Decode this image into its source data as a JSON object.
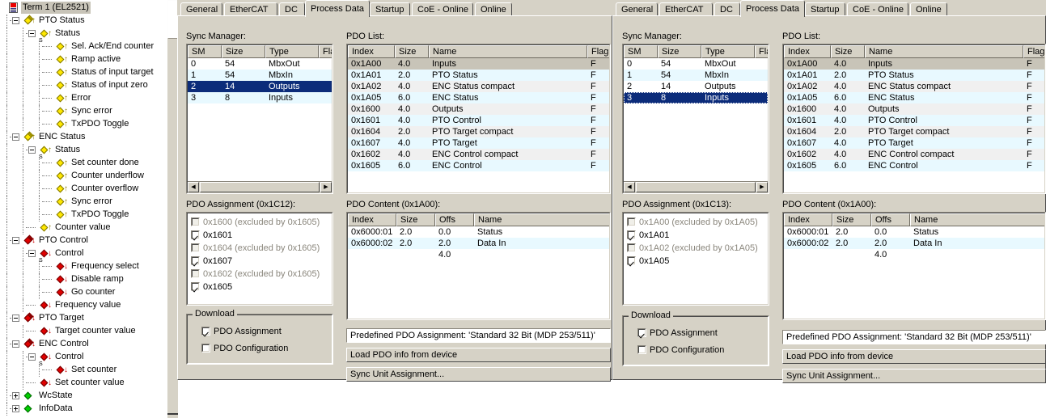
{
  "tree": {
    "root": {
      "label": "Term 1 (EL2521)",
      "icon": "terminal-icon",
      "selected": true
    },
    "nodes": [
      {
        "label": "PTO Status",
        "depth": 1,
        "icon": "pdo-group-input-icon",
        "expander": "minus"
      },
      {
        "label": "Status",
        "depth": 2,
        "icon": "pdo-entry-input-icon",
        "expander": "minus",
        "sub": "S"
      },
      {
        "label": "Sel. Ack/End counter",
        "depth": 3,
        "icon": "variable-input-icon"
      },
      {
        "label": "Ramp active",
        "depth": 3,
        "icon": "variable-input-icon"
      },
      {
        "label": "Status of input target",
        "depth": 3,
        "icon": "variable-input-icon"
      },
      {
        "label": "Status of input zero",
        "depth": 3,
        "icon": "variable-input-icon"
      },
      {
        "label": "Error",
        "depth": 3,
        "icon": "variable-input-icon"
      },
      {
        "label": "Sync error",
        "depth": 3,
        "icon": "variable-input-icon"
      },
      {
        "label": "TxPDO Toggle",
        "depth": 3,
        "icon": "variable-input-icon"
      },
      {
        "label": "ENC Status",
        "depth": 1,
        "icon": "pdo-group-input-icon",
        "expander": "minus"
      },
      {
        "label": "Status",
        "depth": 2,
        "icon": "pdo-entry-input-icon",
        "expander": "minus",
        "sub": "S"
      },
      {
        "label": "Set counter done",
        "depth": 3,
        "icon": "variable-input-icon"
      },
      {
        "label": "Counter underflow",
        "depth": 3,
        "icon": "variable-input-icon"
      },
      {
        "label": "Counter overflow",
        "depth": 3,
        "icon": "variable-input-icon"
      },
      {
        "label": "Sync error",
        "depth": 3,
        "icon": "variable-input-icon"
      },
      {
        "label": "TxPDO Toggle",
        "depth": 3,
        "icon": "variable-input-icon"
      },
      {
        "label": "Counter value",
        "depth": 2,
        "icon": "variable-input-icon"
      },
      {
        "label": "PTO Control",
        "depth": 1,
        "icon": "pdo-group-output-icon",
        "expander": "minus"
      },
      {
        "label": "Control",
        "depth": 2,
        "icon": "pdo-entry-output-icon",
        "expander": "minus",
        "sub": "S"
      },
      {
        "label": "Frequency select",
        "depth": 3,
        "icon": "variable-output-icon"
      },
      {
        "label": "Disable ramp",
        "depth": 3,
        "icon": "variable-output-icon"
      },
      {
        "label": "Go counter",
        "depth": 3,
        "icon": "variable-output-icon"
      },
      {
        "label": "Frequency value",
        "depth": 2,
        "icon": "variable-output-icon"
      },
      {
        "label": "PTO Target",
        "depth": 1,
        "icon": "pdo-group-output-icon",
        "expander": "minus"
      },
      {
        "label": "Target counter value",
        "depth": 2,
        "icon": "variable-output-icon"
      },
      {
        "label": "ENC Control",
        "depth": 1,
        "icon": "pdo-group-output-icon",
        "expander": "minus"
      },
      {
        "label": "Control",
        "depth": 2,
        "icon": "pdo-entry-output-icon",
        "expander": "minus",
        "sub": "S"
      },
      {
        "label": "Set counter",
        "depth": 3,
        "icon": "variable-output-icon"
      },
      {
        "label": "Set counter value",
        "depth": 2,
        "icon": "variable-output-icon"
      },
      {
        "label": "WcState",
        "depth": 1,
        "icon": "wcstate-icon",
        "expander": "plus"
      },
      {
        "label": "InfoData",
        "depth": 1,
        "icon": "infodata-icon",
        "expander": "plus"
      }
    ]
  },
  "tabs": [
    "General",
    "EtherCAT",
    "DC",
    "Process Data",
    "Startup",
    "CoE - Online",
    "Online"
  ],
  "active_tab": "Process Data",
  "labels": {
    "sync_manager": "Sync Manager:",
    "pdo_list": "PDO List:",
    "download": "Download",
    "download_pdo_assignment": "PDO Assignment",
    "download_pdo_configuration": "PDO Configuration"
  },
  "sm_columns": [
    "SM",
    "Size",
    "Type",
    "Flags"
  ],
  "pdo_columns": [
    "Index",
    "Size",
    "Name",
    "Flags"
  ],
  "content_columns": [
    "Index",
    "Size",
    "Offs",
    "Name"
  ],
  "left": {
    "sync_manager_rows": [
      {
        "sm": "0",
        "size": "54",
        "type": "MbxOut",
        "flags": "",
        "style": "plain"
      },
      {
        "sm": "1",
        "size": "54",
        "type": "MbxIn",
        "flags": "",
        "style": "alt"
      },
      {
        "sm": "2",
        "size": "14",
        "type": "Outputs",
        "flags": "",
        "style": "selected"
      },
      {
        "sm": "3",
        "size": "8",
        "type": "Inputs",
        "flags": "",
        "style": "alt"
      }
    ],
    "pdo_list_rows": [
      {
        "index": "0x1A00",
        "size": "4.0",
        "name": "Inputs",
        "flags": "F",
        "style": "hdrsel"
      },
      {
        "index": "0x1A01",
        "size": "2.0",
        "name": "PTO Status",
        "flags": "F",
        "style": "alt"
      },
      {
        "index": "0x1A02",
        "size": "4.0",
        "name": "ENC Status compact",
        "flags": "F",
        "style": "gray"
      },
      {
        "index": "0x1A05",
        "size": "6.0",
        "name": "ENC Status",
        "flags": "F",
        "style": "alt"
      },
      {
        "index": "0x1600",
        "size": "4.0",
        "name": "Outputs",
        "flags": "F",
        "style": "gray"
      },
      {
        "index": "0x1601",
        "size": "4.0",
        "name": "PTO Control",
        "flags": "F",
        "style": "alt"
      },
      {
        "index": "0x1604",
        "size": "2.0",
        "name": "PTO Target compact",
        "flags": "F",
        "style": "gray"
      },
      {
        "index": "0x1607",
        "size": "4.0",
        "name": "PTO Target",
        "flags": "F",
        "style": "alt"
      },
      {
        "index": "0x1602",
        "size": "4.0",
        "name": "ENC Control compact",
        "flags": "F",
        "style": "gray"
      },
      {
        "index": "0x1605",
        "size": "6.0",
        "name": "ENC Control",
        "flags": "F",
        "style": "alt"
      }
    ],
    "pdo_assignment_title": "PDO Assignment (0x1C12):",
    "pdo_assignment_rows": [
      {
        "label": "0x1600 (excluded by 0x1605)",
        "checked": false,
        "disabled": true
      },
      {
        "label": "0x1601",
        "checked": true,
        "disabled": false
      },
      {
        "label": "0x1604 (excluded by 0x1605)",
        "checked": false,
        "disabled": true
      },
      {
        "label": "0x1607",
        "checked": true,
        "disabled": false
      },
      {
        "label": "0x1602 (excluded by 0x1605)",
        "checked": false,
        "disabled": true
      },
      {
        "label": "0x1605",
        "checked": true,
        "disabled": false
      }
    ],
    "pdo_content_title": "PDO Content (0x1A00):",
    "pdo_content_rows": [
      {
        "index": "0x6000:01",
        "size": "2.0",
        "offs": "0.0",
        "name": "Status",
        "style": "plain"
      },
      {
        "index": "0x6000:02",
        "size": "2.0",
        "offs": "2.0",
        "name": "Data In",
        "style": "alt"
      },
      {
        "index": "",
        "size": "",
        "offs": "4.0",
        "name": "",
        "style": "plain"
      }
    ],
    "download_assignment_checked": true,
    "download_configuration_checked": false,
    "predefined_pdo_assignment": "Predefined PDO Assignment: 'Standard 32 Bit (MDP 253/511)'",
    "load_pdo_info": "Load PDO info from device",
    "sync_unit_assignment": "Sync Unit Assignment..."
  },
  "right": {
    "sync_manager_rows": [
      {
        "sm": "0",
        "size": "54",
        "type": "MbxOut",
        "flags": "",
        "style": "plain"
      },
      {
        "sm": "1",
        "size": "54",
        "type": "MbxIn",
        "flags": "",
        "style": "alt"
      },
      {
        "sm": "2",
        "size": "14",
        "type": "Outputs",
        "flags": "",
        "style": "plain"
      },
      {
        "sm": "3",
        "size": "8",
        "type": "Inputs",
        "flags": "",
        "style": "selected-focus"
      }
    ],
    "pdo_list_rows": [
      {
        "index": "0x1A00",
        "size": "4.0",
        "name": "Inputs",
        "flags": "F",
        "style": "hdrsel"
      },
      {
        "index": "0x1A01",
        "size": "2.0",
        "name": "PTO Status",
        "flags": "F",
        "style": "alt"
      },
      {
        "index": "0x1A02",
        "size": "4.0",
        "name": "ENC Status compact",
        "flags": "F",
        "style": "gray"
      },
      {
        "index": "0x1A05",
        "size": "6.0",
        "name": "ENC Status",
        "flags": "F",
        "style": "alt"
      },
      {
        "index": "0x1600",
        "size": "4.0",
        "name": "Outputs",
        "flags": "F",
        "style": "gray"
      },
      {
        "index": "0x1601",
        "size": "4.0",
        "name": "PTO Control",
        "flags": "F",
        "style": "alt"
      },
      {
        "index": "0x1604",
        "size": "2.0",
        "name": "PTO Target compact",
        "flags": "F",
        "style": "gray"
      },
      {
        "index": "0x1607",
        "size": "4.0",
        "name": "PTO Target",
        "flags": "F",
        "style": "alt"
      },
      {
        "index": "0x1602",
        "size": "4.0",
        "name": "ENC Control compact",
        "flags": "F",
        "style": "gray"
      },
      {
        "index": "0x1605",
        "size": "6.0",
        "name": "ENC Control",
        "flags": "F",
        "style": "alt"
      }
    ],
    "pdo_assignment_title": "PDO Assignment (0x1C13):",
    "pdo_assignment_rows": [
      {
        "label": "0x1A00 (excluded by 0x1A05)",
        "checked": false,
        "disabled": true
      },
      {
        "label": "0x1A01",
        "checked": true,
        "disabled": false
      },
      {
        "label": "0x1A02 (excluded by 0x1A05)",
        "checked": false,
        "disabled": true
      },
      {
        "label": "0x1A05",
        "checked": true,
        "disabled": false
      }
    ],
    "pdo_content_title": "PDO Content (0x1A00):",
    "pdo_content_rows": [
      {
        "index": "0x6000:01",
        "size": "2.0",
        "offs": "0.0",
        "name": "Status",
        "style": "plain"
      },
      {
        "index": "0x6000:02",
        "size": "2.0",
        "offs": "2.0",
        "name": "Data In",
        "style": "alt"
      },
      {
        "index": "",
        "size": "",
        "offs": "4.0",
        "name": "",
        "style": "plain"
      }
    ],
    "download_assignment_checked": true,
    "download_configuration_checked": false,
    "predefined_pdo_assignment": "Predefined PDO Assignment: 'Standard 32 Bit (MDP 253/511)'",
    "load_pdo_info": "Load PDO info from device",
    "sync_unit_assignment": "Sync Unit Assignment..."
  },
  "colors": {
    "face": "#d6d2c6",
    "selection": "#0c2c7a",
    "alt_row": "#e8f9ff",
    "gray_row": "#f0f0f0",
    "header_sel_row": "#c8c4b8",
    "input_icon": "#ffe800",
    "output_icon": "#e00000",
    "info_icon": "#00d000"
  }
}
